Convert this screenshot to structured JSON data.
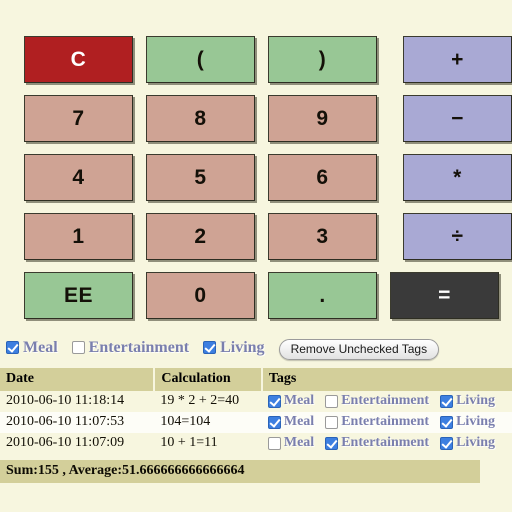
{
  "keypad": {
    "rows": [
      [
        {
          "label": "C",
          "kind": "clear",
          "name": "key-clear"
        },
        {
          "label": "(",
          "kind": "paren",
          "name": "key-open-paren"
        },
        {
          "label": ")",
          "kind": "paren",
          "name": "key-close-paren"
        },
        {
          "label": "+",
          "kind": "op",
          "name": "key-plus"
        }
      ],
      [
        {
          "label": "7",
          "kind": "num",
          "name": "key-7"
        },
        {
          "label": "8",
          "kind": "num",
          "name": "key-8"
        },
        {
          "label": "9",
          "kind": "num",
          "name": "key-9"
        },
        {
          "label": "−",
          "kind": "op",
          "name": "key-minus"
        }
      ],
      [
        {
          "label": "4",
          "kind": "num",
          "name": "key-4"
        },
        {
          "label": "5",
          "kind": "num",
          "name": "key-5"
        },
        {
          "label": "6",
          "kind": "num",
          "name": "key-6"
        },
        {
          "label": "*",
          "kind": "op",
          "name": "key-multiply"
        }
      ],
      [
        {
          "label": "1",
          "kind": "num",
          "name": "key-1"
        },
        {
          "label": "2",
          "kind": "num",
          "name": "key-2"
        },
        {
          "label": "3",
          "kind": "num",
          "name": "key-3"
        },
        {
          "label": "÷",
          "kind": "op",
          "name": "key-divide"
        }
      ],
      [
        {
          "label": "EE",
          "kind": "paren",
          "name": "key-ee"
        },
        {
          "label": "0",
          "kind": "num",
          "name": "key-0"
        },
        {
          "label": ".",
          "kind": "paren",
          "name": "key-decimal"
        },
        {
          "label": "=",
          "kind": "equals",
          "name": "key-equals"
        }
      ]
    ]
  },
  "tag_filter": {
    "tags": [
      {
        "label": "Meal",
        "checked": true
      },
      {
        "label": "Entertainment",
        "checked": false
      },
      {
        "label": "Living",
        "checked": true
      }
    ],
    "remove_button_label": "Remove Unchecked Tags"
  },
  "history": {
    "columns": [
      "Date",
      "Calculation",
      "Tags"
    ],
    "rows": [
      {
        "date": "2010-06-10 11:18:14",
        "calculation": "19 * 2 + 2=40",
        "tags": [
          {
            "label": "Meal",
            "checked": true
          },
          {
            "label": "Entertainment",
            "checked": false
          },
          {
            "label": "Living",
            "checked": true
          }
        ]
      },
      {
        "date": "2010-06-10 11:07:53",
        "calculation": "104=104",
        "tags": [
          {
            "label": "Meal",
            "checked": true
          },
          {
            "label": "Entertainment",
            "checked": false
          },
          {
            "label": "Living",
            "checked": true
          }
        ]
      },
      {
        "date": "2010-06-10 11:07:09",
        "calculation": "10 + 1=11",
        "tags": [
          {
            "label": "Meal",
            "checked": false
          },
          {
            "label": "Entertainment",
            "checked": true
          },
          {
            "label": "Living",
            "checked": true
          }
        ]
      }
    ]
  },
  "summary": {
    "text": "Sum:155 , Average:51.666666666666664"
  },
  "colors": {
    "background": "#f7f6df",
    "number_key": "#cfa394",
    "paren_key": "#98c795",
    "operator_key": "#a9a9d4",
    "clear_key": "#b01f21",
    "equals_key": "#3a3a3a",
    "header_bar": "#d3cf9a",
    "tag_text": "#7a7fae",
    "checkbox_checked": "#3d7fe0"
  }
}
